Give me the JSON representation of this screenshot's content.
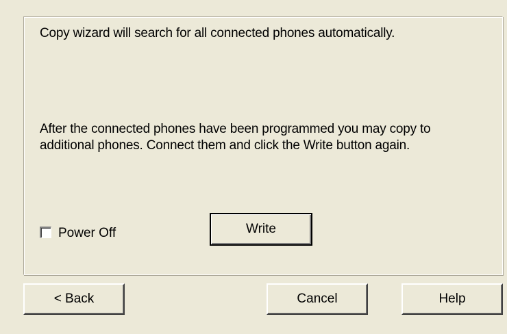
{
  "panel": {
    "message_1": "Copy wizard will search for all connected phones automatically.",
    "message_2": "After the connected phones have been programmed you may copy to additional phones. Connect them and click the Write button again."
  },
  "options": {
    "power_off_label": "Power Off",
    "power_off_checked": false
  },
  "buttons": {
    "write_label": "Write",
    "back_label": "< Back",
    "cancel_label": "Cancel",
    "help_label": "Help"
  },
  "colors": {
    "dialog_background": "#ece9d8"
  }
}
